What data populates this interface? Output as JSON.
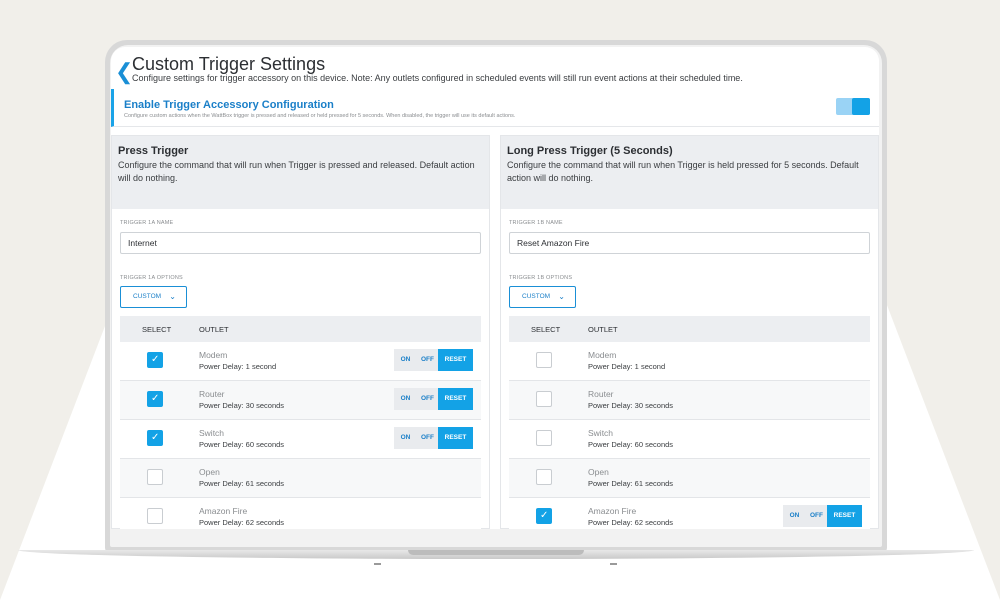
{
  "header": {
    "title": "Custom Trigger Settings",
    "subtitle": "Configure settings for trigger accessory on this device. Note: Any outlets configured in scheduled events will still run event actions at their scheduled time."
  },
  "enable": {
    "title": "Enable Trigger Accessory Configuration",
    "description": "Configure custom actions when the WattBox trigger is pressed and released or held pressed for 5 seconds. When disabled, the trigger will use its default actions.",
    "enabled": true
  },
  "colors": {
    "accent": "#13a2e6",
    "panel_header": "#eceef1"
  },
  "press": {
    "title": "Press Trigger",
    "description": "Configure the command that will run when Trigger is pressed and released. Default action will do nothing.",
    "name_label": "TRIGGER 1A NAME",
    "name_value": "Internet",
    "options_label": "TRIGGER 1A OPTIONS",
    "option_selected": "CUSTOM",
    "col_select": "SELECT",
    "col_outlet": "OUTLET",
    "rows": [
      {
        "name": "Modem",
        "delay": "Power Delay: 1 second",
        "checked": true
      },
      {
        "name": "Router",
        "delay": "Power Delay: 30 seconds",
        "checked": true
      },
      {
        "name": "Switch",
        "delay": "Power Delay: 60 seconds",
        "checked": true
      },
      {
        "name": "Open",
        "delay": "Power Delay: 61 seconds",
        "checked": false
      },
      {
        "name": "Amazon Fire",
        "delay": "Power Delay: 62 seconds",
        "checked": false
      }
    ]
  },
  "long": {
    "title": "Long Press Trigger (5 Seconds)",
    "description": "Configure the command that will run when Trigger is held pressed for 5 seconds. Default action will do nothing.",
    "name_label": "TRIGGER 1B NAME",
    "name_value": "Reset Amazon Fire",
    "options_label": "TRIGGER 1B OPTIONS",
    "option_selected": "CUSTOM",
    "col_select": "SELECT",
    "col_outlet": "OUTLET",
    "rows": [
      {
        "name": "Modem",
        "delay": "Power Delay: 1 second",
        "checked": false
      },
      {
        "name": "Router",
        "delay": "Power Delay: 30 seconds",
        "checked": false
      },
      {
        "name": "Switch",
        "delay": "Power Delay: 60 seconds",
        "checked": false
      },
      {
        "name": "Open",
        "delay": "Power Delay: 61 seconds",
        "checked": false
      },
      {
        "name": "Amazon Fire",
        "delay": "Power Delay: 62 seconds",
        "checked": true
      }
    ]
  },
  "buttons": {
    "on": "ON",
    "off": "OFF",
    "reset": "RESET"
  }
}
